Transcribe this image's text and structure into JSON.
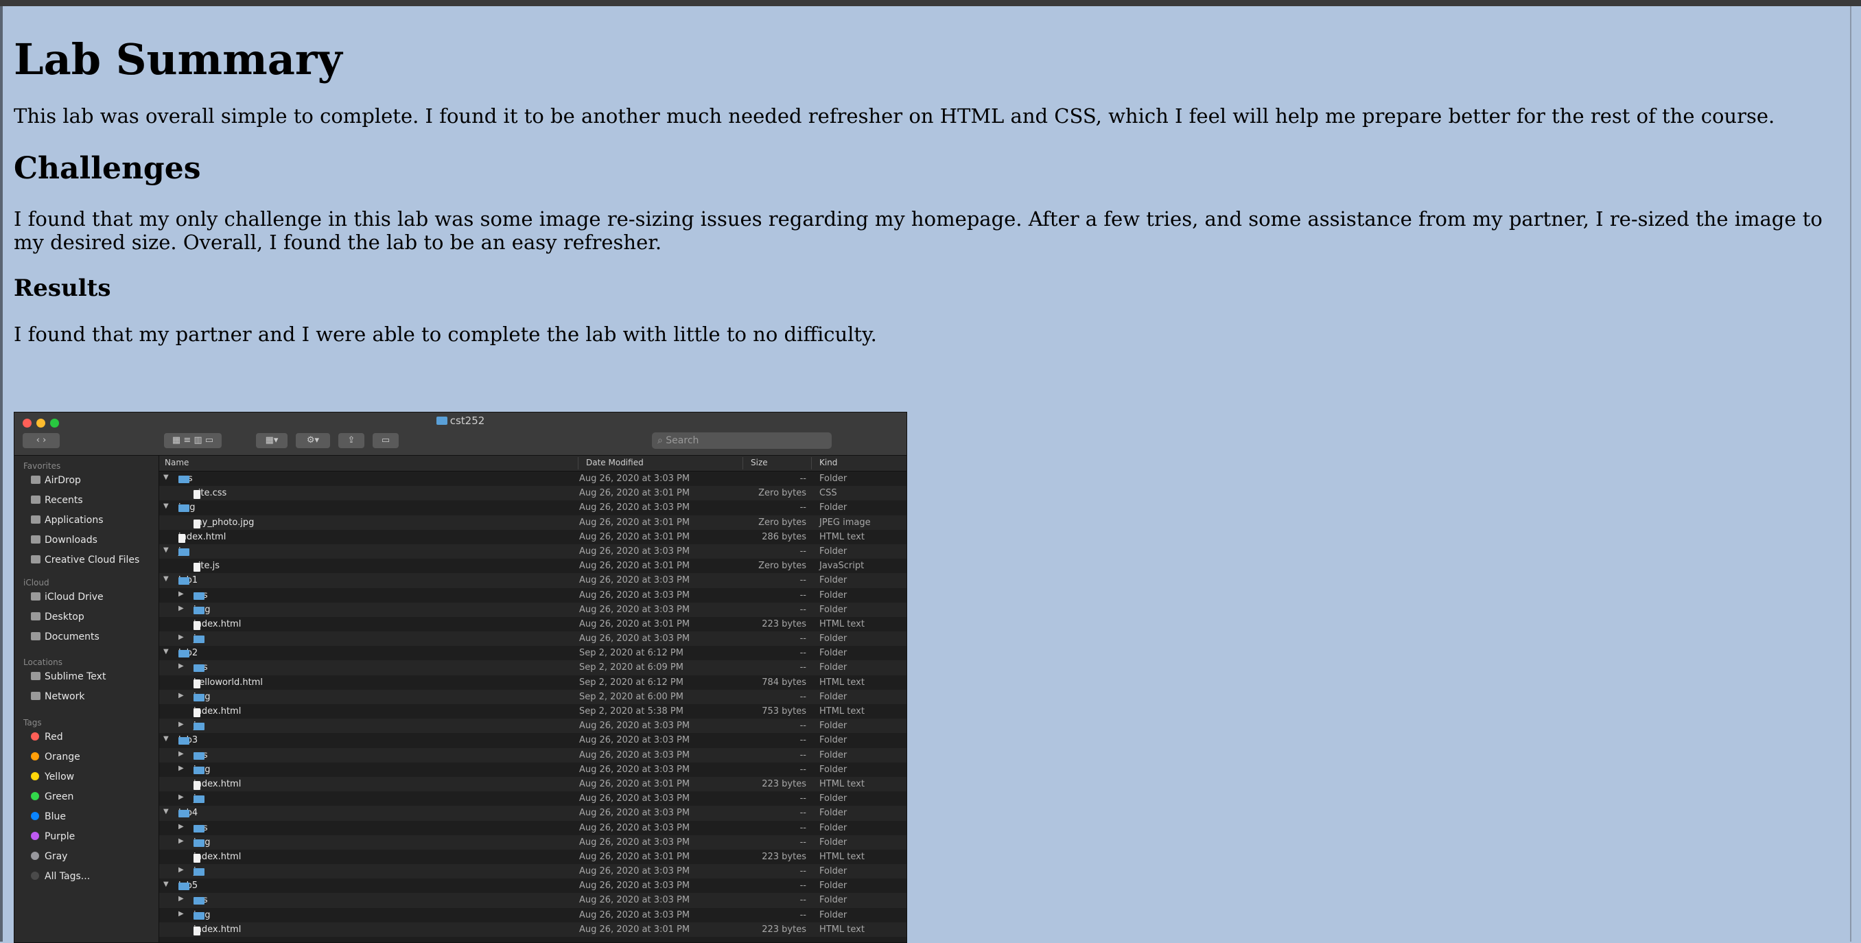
{
  "page": {
    "title": "Lab Summary",
    "intro": "This lab was overall simple to complete. I found it to be another much needed refresher on HTML and CSS, which I feel will help me prepare better for the rest of the course.",
    "challenges_heading": "Challenges",
    "challenges_text": "I found that my only challenge in this lab was some image re-sizing issues regarding my homepage. After a few tries, and some assistance from my partner, I re-sized the image to my desired size. Overall, I found the lab to be an easy refresher.",
    "results_heading": "Results",
    "results_text": "I found that my partner and I were able to complete the lab with little to no difficulty."
  },
  "finder": {
    "window_title": "cst252",
    "search_placeholder": "Search",
    "columns": {
      "name": "Name",
      "date": "Date Modified",
      "size": "Size",
      "kind": "Kind"
    },
    "sidebar": {
      "favorites_label": "Favorites",
      "favorites": [
        "AirDrop",
        "Recents",
        "Applications",
        "Downloads",
        "Creative Cloud Files"
      ],
      "icloud_label": "iCloud",
      "icloud": [
        "iCloud Drive",
        "Desktop",
        "Documents"
      ],
      "locations_label": "Locations",
      "locations": [
        "Sublime Text",
        "Network"
      ],
      "tags_label": "Tags",
      "tags": [
        {
          "name": "Red",
          "color": "#ff5f57"
        },
        {
          "name": "Orange",
          "color": "#ff9f0a"
        },
        {
          "name": "Yellow",
          "color": "#ffd60a"
        },
        {
          "name": "Green",
          "color": "#32d74b"
        },
        {
          "name": "Blue",
          "color": "#0a84ff"
        },
        {
          "name": "Purple",
          "color": "#bf5af2"
        },
        {
          "name": "Gray",
          "color": "#98989d"
        },
        {
          "name": "All Tags...",
          "color": "#4a4a4a"
        }
      ]
    },
    "rows": [
      {
        "name": "css",
        "depth": 0,
        "type": "folder",
        "tri": "down",
        "date": "Aug 26, 2020 at 3:03 PM",
        "size": "--",
        "kind": "Folder"
      },
      {
        "name": "site.css",
        "depth": 1,
        "type": "file",
        "tri": "",
        "date": "Aug 26, 2020 at 3:01 PM",
        "size": "Zero bytes",
        "kind": "CSS"
      },
      {
        "name": "img",
        "depth": 0,
        "type": "folder",
        "tri": "down",
        "date": "Aug 26, 2020 at 3:03 PM",
        "size": "--",
        "kind": "Folder"
      },
      {
        "name": "my_photo.jpg",
        "depth": 1,
        "type": "file",
        "tri": "",
        "date": "Aug 26, 2020 at 3:01 PM",
        "size": "Zero bytes",
        "kind": "JPEG image"
      },
      {
        "name": "index.html",
        "depth": 0,
        "type": "file",
        "tri": "",
        "date": "Aug 26, 2020 at 3:01 PM",
        "size": "286 bytes",
        "kind": "HTML text"
      },
      {
        "name": "js",
        "depth": 0,
        "type": "folder",
        "tri": "down",
        "date": "Aug 26, 2020 at 3:03 PM",
        "size": "--",
        "kind": "Folder"
      },
      {
        "name": "site.js",
        "depth": 1,
        "type": "file",
        "tri": "",
        "date": "Aug 26, 2020 at 3:01 PM",
        "size": "Zero bytes",
        "kind": "JavaScript"
      },
      {
        "name": "lab1",
        "depth": 0,
        "type": "folder",
        "tri": "down",
        "date": "Aug 26, 2020 at 3:03 PM",
        "size": "--",
        "kind": "Folder"
      },
      {
        "name": "css",
        "depth": 1,
        "type": "folder",
        "tri": "right",
        "date": "Aug 26, 2020 at 3:03 PM",
        "size": "--",
        "kind": "Folder"
      },
      {
        "name": "img",
        "depth": 1,
        "type": "folder",
        "tri": "right",
        "date": "Aug 26, 2020 at 3:03 PM",
        "size": "--",
        "kind": "Folder"
      },
      {
        "name": "index.html",
        "depth": 1,
        "type": "file",
        "tri": "",
        "date": "Aug 26, 2020 at 3:01 PM",
        "size": "223 bytes",
        "kind": "HTML text"
      },
      {
        "name": "js",
        "depth": 1,
        "type": "folder",
        "tri": "right",
        "date": "Aug 26, 2020 at 3:03 PM",
        "size": "--",
        "kind": "Folder"
      },
      {
        "name": "lab2",
        "depth": 0,
        "type": "folder",
        "tri": "down",
        "date": "Sep 2, 2020 at 6:12 PM",
        "size": "--",
        "kind": "Folder"
      },
      {
        "name": "css",
        "depth": 1,
        "type": "folder",
        "tri": "right",
        "date": "Sep 2, 2020 at 6:09 PM",
        "size": "--",
        "kind": "Folder"
      },
      {
        "name": "helloworld.html",
        "depth": 1,
        "type": "file",
        "tri": "",
        "date": "Sep 2, 2020 at 6:12 PM",
        "size": "784 bytes",
        "kind": "HTML text"
      },
      {
        "name": "img",
        "depth": 1,
        "type": "folder",
        "tri": "right",
        "date": "Sep 2, 2020 at 6:00 PM",
        "size": "--",
        "kind": "Folder"
      },
      {
        "name": "index.html",
        "depth": 1,
        "type": "file",
        "tri": "",
        "date": "Sep 2, 2020 at 5:38 PM",
        "size": "753 bytes",
        "kind": "HTML text"
      },
      {
        "name": "js",
        "depth": 1,
        "type": "folder",
        "tri": "right",
        "date": "Aug 26, 2020 at 3:03 PM",
        "size": "--",
        "kind": "Folder"
      },
      {
        "name": "lab3",
        "depth": 0,
        "type": "folder",
        "tri": "down",
        "date": "Aug 26, 2020 at 3:03 PM",
        "size": "--",
        "kind": "Folder"
      },
      {
        "name": "css",
        "depth": 1,
        "type": "folder",
        "tri": "right",
        "date": "Aug 26, 2020 at 3:03 PM",
        "size": "--",
        "kind": "Folder"
      },
      {
        "name": "img",
        "depth": 1,
        "type": "folder",
        "tri": "right",
        "date": "Aug 26, 2020 at 3:03 PM",
        "size": "--",
        "kind": "Folder"
      },
      {
        "name": "index.html",
        "depth": 1,
        "type": "file",
        "tri": "",
        "date": "Aug 26, 2020 at 3:01 PM",
        "size": "223 bytes",
        "kind": "HTML text"
      },
      {
        "name": "js",
        "depth": 1,
        "type": "folder",
        "tri": "right",
        "date": "Aug 26, 2020 at 3:03 PM",
        "size": "--",
        "kind": "Folder"
      },
      {
        "name": "lab4",
        "depth": 0,
        "type": "folder",
        "tri": "down",
        "date": "Aug 26, 2020 at 3:03 PM",
        "size": "--",
        "kind": "Folder"
      },
      {
        "name": "css",
        "depth": 1,
        "type": "folder",
        "tri": "right",
        "date": "Aug 26, 2020 at 3:03 PM",
        "size": "--",
        "kind": "Folder"
      },
      {
        "name": "img",
        "depth": 1,
        "type": "folder",
        "tri": "right",
        "date": "Aug 26, 2020 at 3:03 PM",
        "size": "--",
        "kind": "Folder"
      },
      {
        "name": "index.html",
        "depth": 1,
        "type": "file",
        "tri": "",
        "date": "Aug 26, 2020 at 3:01 PM",
        "size": "223 bytes",
        "kind": "HTML text"
      },
      {
        "name": "js",
        "depth": 1,
        "type": "folder",
        "tri": "right",
        "date": "Aug 26, 2020 at 3:03 PM",
        "size": "--",
        "kind": "Folder"
      },
      {
        "name": "lab5",
        "depth": 0,
        "type": "folder",
        "tri": "down",
        "date": "Aug 26, 2020 at 3:03 PM",
        "size": "--",
        "kind": "Folder"
      },
      {
        "name": "css",
        "depth": 1,
        "type": "folder",
        "tri": "right",
        "date": "Aug 26, 2020 at 3:03 PM",
        "size": "--",
        "kind": "Folder"
      },
      {
        "name": "img",
        "depth": 1,
        "type": "folder",
        "tri": "right",
        "date": "Aug 26, 2020 at 3:03 PM",
        "size": "--",
        "kind": "Folder"
      },
      {
        "name": "index.html",
        "depth": 1,
        "type": "file",
        "tri": "",
        "date": "Aug 26, 2020 at 3:01 PM",
        "size": "223 bytes",
        "kind": "HTML text"
      }
    ]
  }
}
